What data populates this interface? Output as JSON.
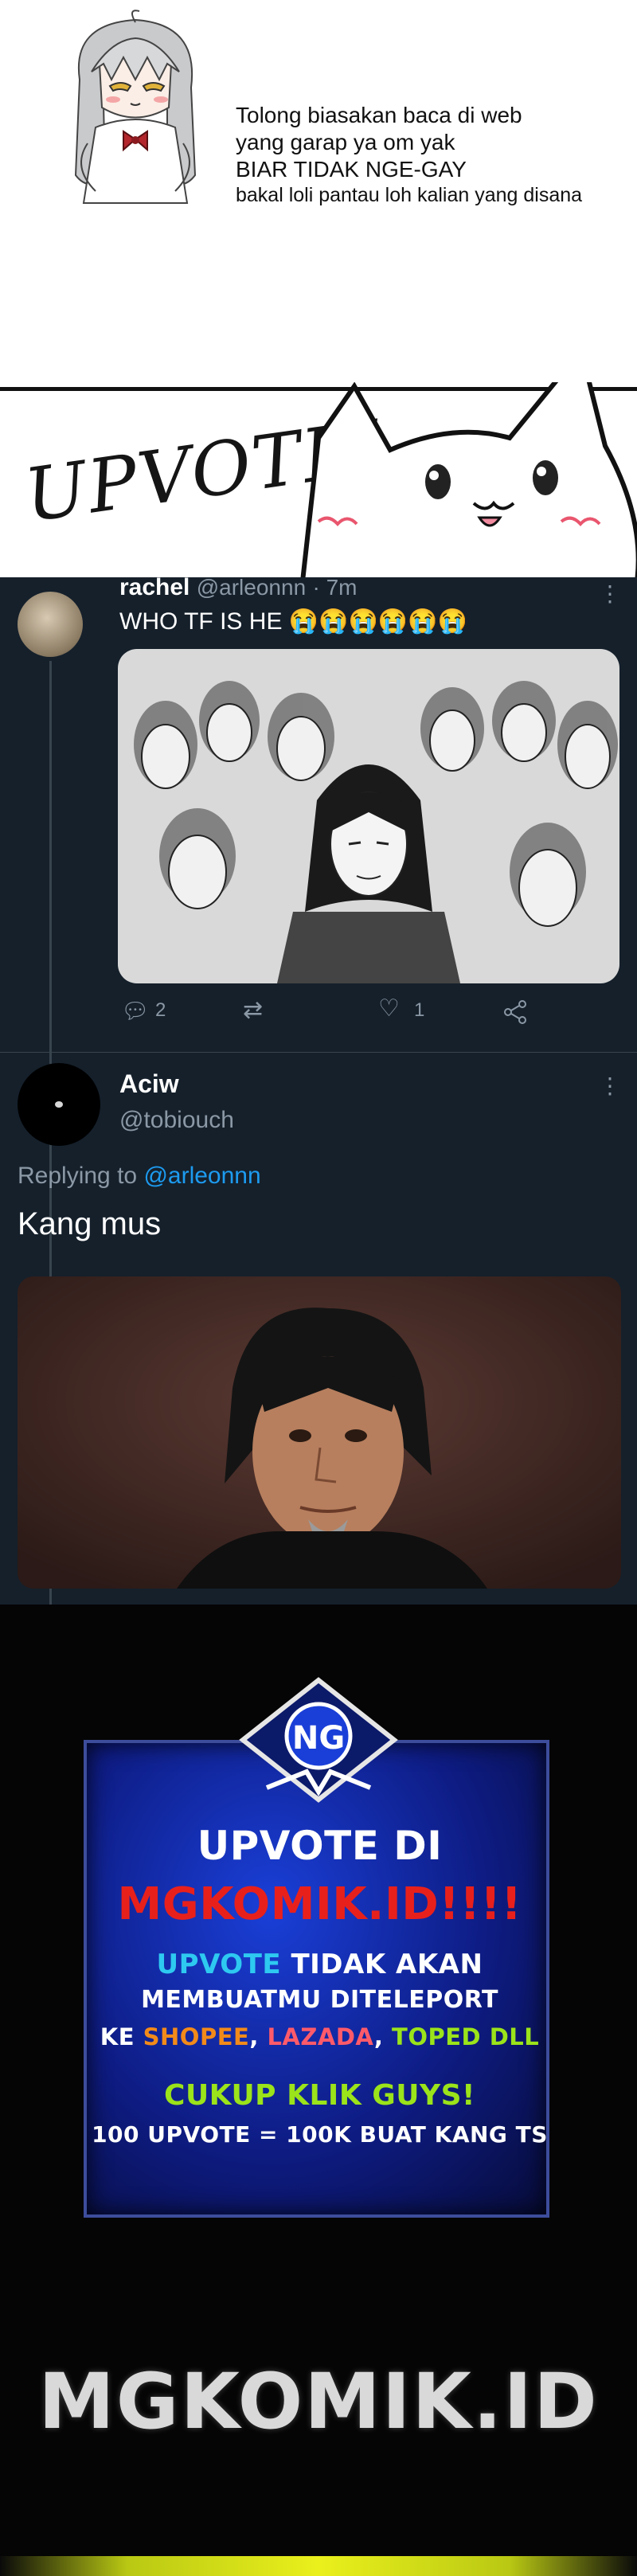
{
  "notice": {
    "lines": [
      "Tolong biasakan baca di web",
      "yang garap ya om yak",
      "BIAR TIDAK NGE-GAY",
      "bakal loli pantau loh kalian yang disana"
    ]
  },
  "upvote_banner": {
    "text": "UPVOTE!"
  },
  "tweets": {
    "first": {
      "name": "rachel",
      "handle": "@arleonnn",
      "time": "· 7m",
      "text": "WHO TF IS HE 😭😭😭😭😭😭",
      "replies": "2",
      "likes": "1"
    },
    "second": {
      "name": "Aciw",
      "handle": "@tobiouch",
      "replying_prefix": "Replying to ",
      "replying_to": "@arleonnn",
      "text": "Kang mus"
    }
  },
  "ad": {
    "logo": "NG",
    "line1": "UPVOTE DI",
    "line2": "MGKOMIK.ID!!!!",
    "line3a": "UPVOTE",
    "line3b": " TIDAK AKAN",
    "line4": "MEMBUATMU DITELEPORT",
    "line5a": "KE ",
    "line5b": "SHOPEE",
    "line5c": ", ",
    "line5d": "LAZADA",
    "line5e": ", ",
    "line5f": "TOPED DLL",
    "line6": "CUKUP KLIK GUYS!",
    "line7": "100 UPVOTE = 100K BUAT KANG TS",
    "brand": "MGKOMIK.ID"
  },
  "colors": {
    "twitter_bg": "#15202b",
    "link": "#1d9bf0",
    "ad_red": "#e8201c",
    "ad_yellow": "#f3e21a",
    "ad_cyan": "#2ec9f0",
    "ad_green": "#9be31a"
  }
}
